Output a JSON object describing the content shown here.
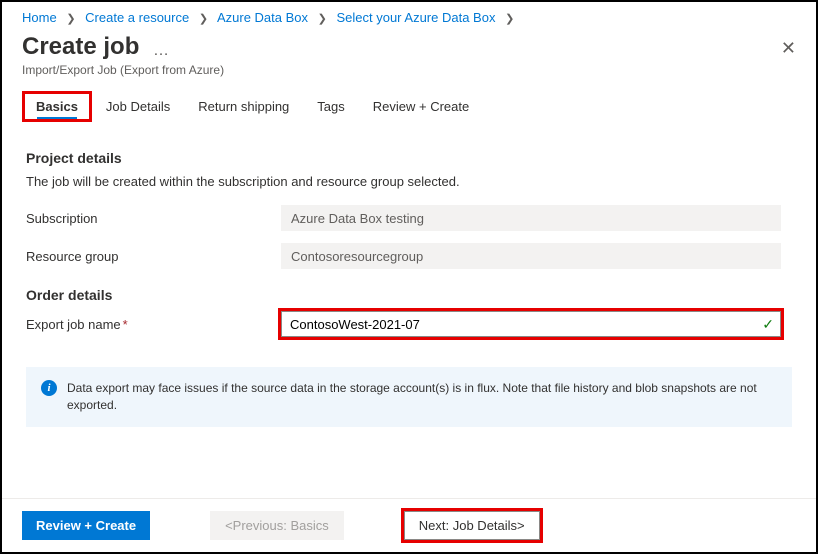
{
  "breadcrumb": [
    {
      "label": "Home"
    },
    {
      "label": "Create a resource"
    },
    {
      "label": "Azure Data Box"
    },
    {
      "label": "Select your Azure Data Box"
    }
  ],
  "header": {
    "title": "Create job",
    "subtitle": "Import/Export Job (Export from Azure)"
  },
  "tabs": [
    {
      "label": "Basics",
      "active": true,
      "highlighted": true
    },
    {
      "label": "Job Details"
    },
    {
      "label": "Return shipping"
    },
    {
      "label": "Tags"
    },
    {
      "label": "Review + Create"
    }
  ],
  "sections": {
    "project": {
      "title": "Project details",
      "description": "The job will be created within the subscription and resource group selected.",
      "subscription_label": "Subscription",
      "subscription_value": "Azure Data Box testing",
      "resource_group_label": "Resource group",
      "resource_group_value": "Contosoresourcegroup"
    },
    "order": {
      "title": "Order details",
      "jobname_label": "Export job name",
      "jobname_value": "ContosoWest-2021-07",
      "jobname_valid": true
    }
  },
  "info_box": {
    "text": "Data export may face issues if the source data in the storage account(s) is in flux. Note that file history and blob snapshots are not exported."
  },
  "footer": {
    "review": "Review + Create",
    "previous": "<Previous: Basics",
    "next": "Next: Job Details>"
  }
}
